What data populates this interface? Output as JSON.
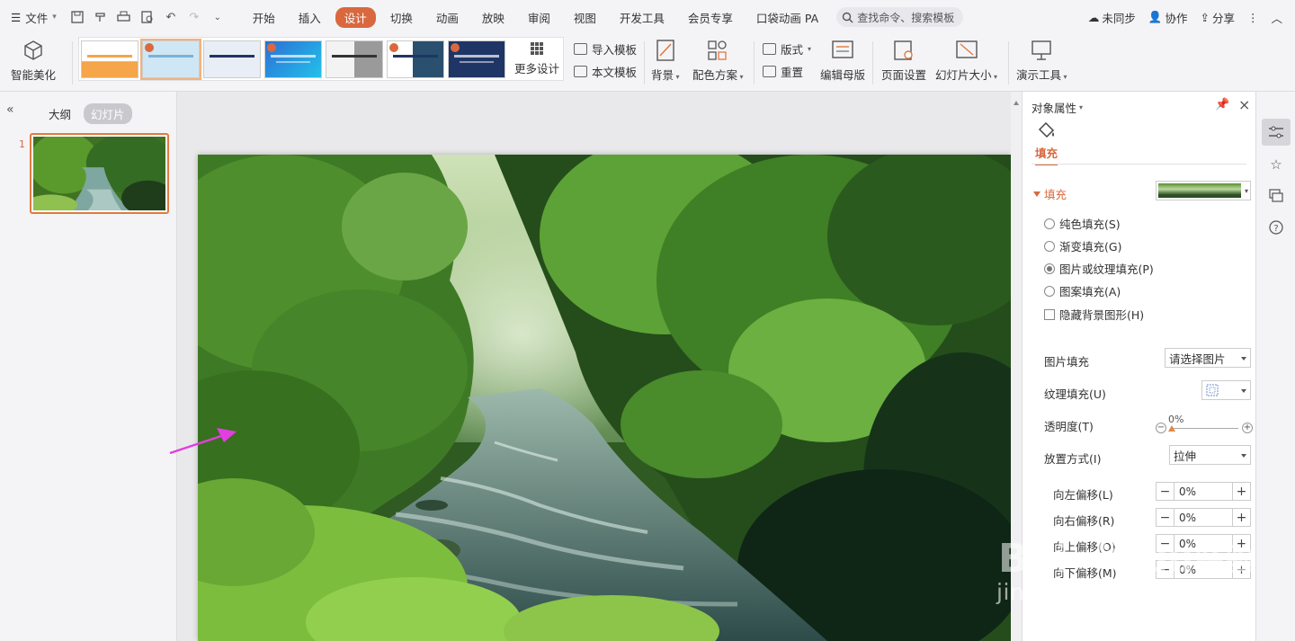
{
  "menubar": {
    "file_label": "文件",
    "tabs": [
      "开始",
      "插入",
      "设计",
      "切换",
      "动画",
      "放映",
      "审阅",
      "视图",
      "开发工具",
      "会员专享",
      "口袋动画 PA"
    ],
    "active_tab": "设计",
    "search_placeholder": "查找命令、搜索模板",
    "sync_label": "未同步",
    "collab_label": "协作",
    "share_label": "分享"
  },
  "ribbon": {
    "beautify_label": "智能美化",
    "more_design_label": "更多设计",
    "import_template_label": "导入模板",
    "this_template_label": "本文模板",
    "background_label": "背景",
    "color_scheme_label": "配色方案",
    "layout_label": "版式",
    "reset_label": "重置",
    "edit_master_label": "编辑母版",
    "page_setup_label": "页面设置",
    "slide_size_label": "幻灯片大小",
    "presenter_tools_label": "演示工具",
    "thumb_colors": [
      "#f5a54a",
      "#cfe7f4",
      "#e9eef6",
      "#2d6fd6",
      "#f3f3f3",
      "#ffffff",
      "#1e3566"
    ]
  },
  "leftpanel": {
    "outline_tab": "大纲",
    "slides_tab": "幻灯片",
    "slide_number": "1"
  },
  "props": {
    "title": "对象属性",
    "fill_tab": "填充",
    "fill_section": "填充",
    "fill_options": [
      {
        "label": "纯色填充(S)",
        "selected": false
      },
      {
        "label": "渐变填充(G)",
        "selected": false
      },
      {
        "label": "图片或纹理填充(P)",
        "selected": true
      },
      {
        "label": "图案填充(A)",
        "selected": false
      }
    ],
    "hide_bg_label": "隐藏背景图形(H)",
    "picture_fill_label": "图片填充",
    "picture_fill_value": "请选择图片",
    "texture_fill_label": "纹理填充(U)",
    "transparency_label": "透明度(T)",
    "transparency_value": "0%",
    "placement_label": "放置方式(I)",
    "placement_value": "拉伸",
    "offsets": [
      {
        "label": "向左偏移(L)",
        "value": "0%"
      },
      {
        "label": "向右偏移(R)",
        "value": "0%"
      },
      {
        "label": "向上偏移(O)",
        "value": "0%"
      },
      {
        "label": "向下偏移(M)",
        "value": "0%"
      }
    ]
  },
  "watermark": {
    "brand": "Baidu 经验",
    "url": "jingyan.baidu.com"
  }
}
